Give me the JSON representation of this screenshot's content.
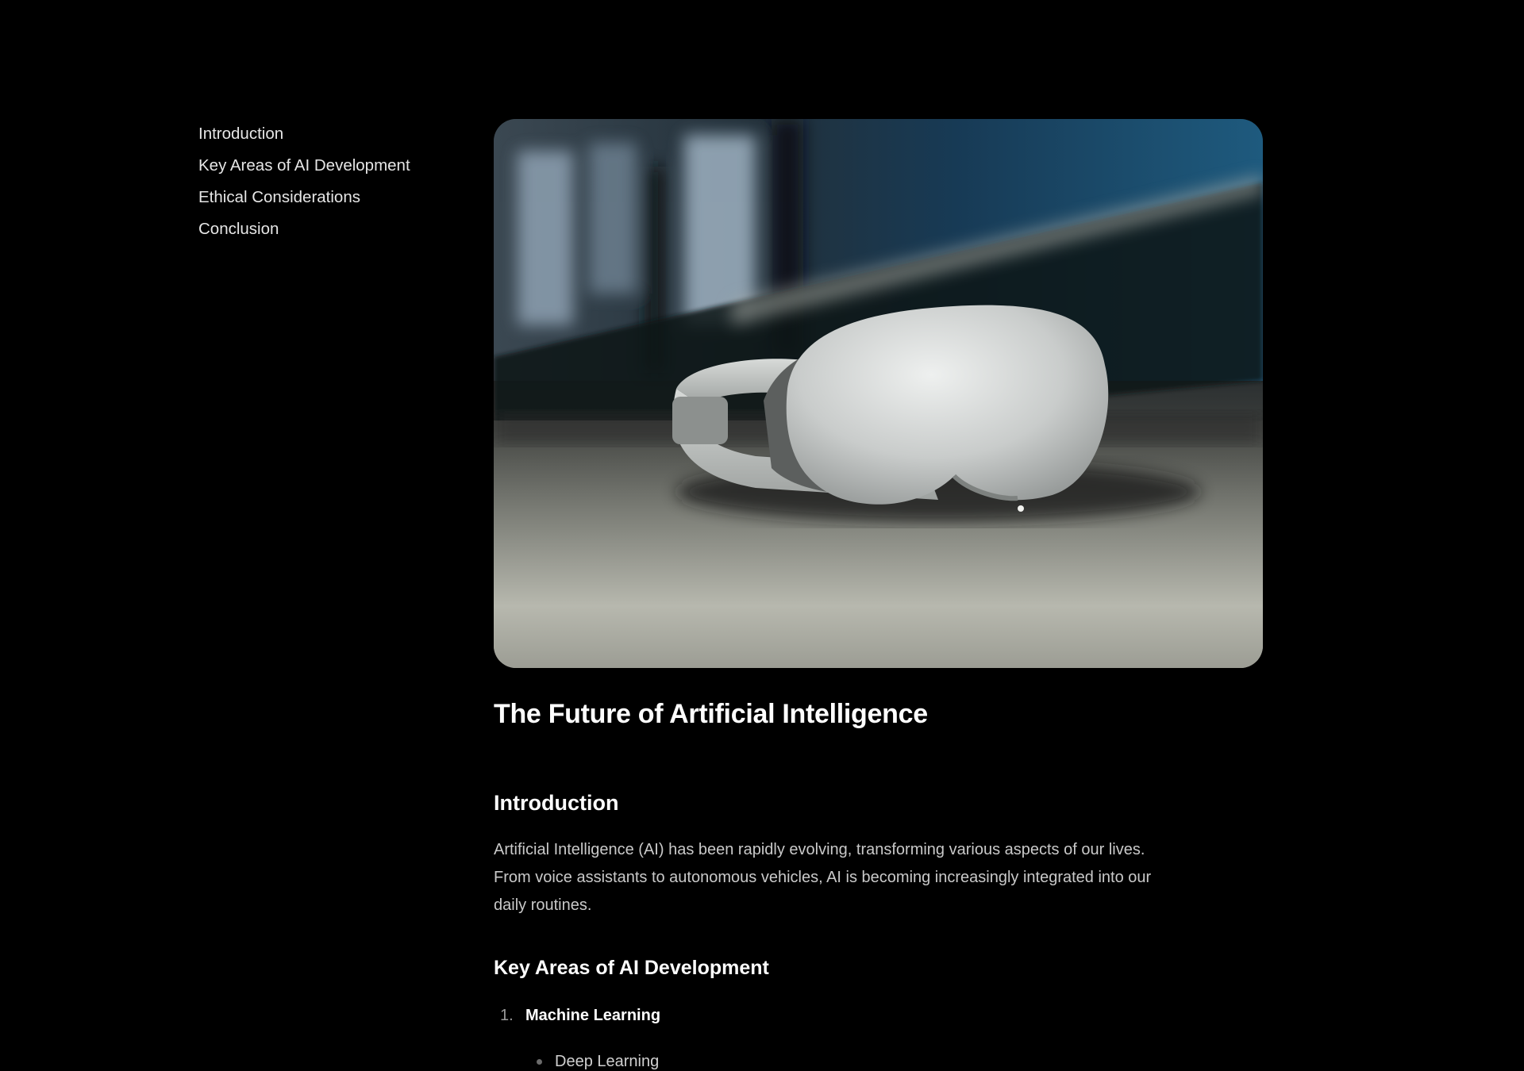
{
  "toc": {
    "items": [
      {
        "label": "Introduction"
      },
      {
        "label": "Key Areas of AI Development"
      },
      {
        "label": "Ethical Considerations"
      },
      {
        "label": "Conclusion"
      }
    ]
  },
  "hero": {
    "subject": "vr-headset-on-table"
  },
  "article": {
    "title": "The Future of Artificial Intelligence",
    "intro": {
      "heading": "Introduction",
      "body": "Artificial Intelligence (AI) has been rapidly evolving, transforming various aspects of our lives. From voice assistants to autonomous vehicles, AI is becoming increasingly integrated into our daily routines."
    },
    "key_areas": {
      "heading": "Key Areas of AI Development",
      "items": [
        {
          "marker": "1.",
          "label": "Machine Learning",
          "subitems": [
            "Deep Learning"
          ]
        }
      ]
    }
  },
  "colors": {
    "background": "#000000",
    "text": "#ffffff",
    "body_text": "#c9c9c9"
  }
}
